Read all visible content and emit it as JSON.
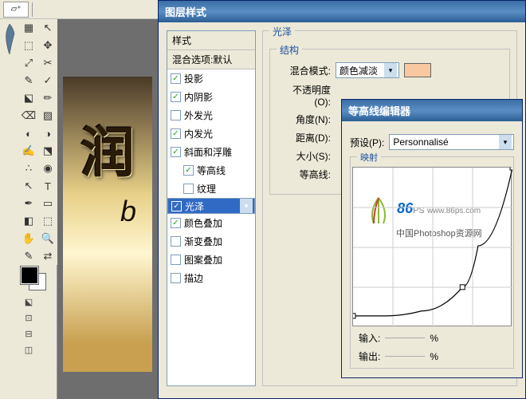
{
  "toolbar": {
    "selector": "▱⁺"
  },
  "toolbox": {
    "tools": [
      "▦",
      "↖",
      "⬚",
      "✥",
      "⤢",
      "✂",
      "✎",
      "✓",
      "⬕",
      "✏",
      "⌫",
      "▨",
      "◐",
      "◑",
      "✍",
      "⬔",
      "∴",
      "◉",
      "↖",
      "T",
      "✒",
      "▭",
      "◧",
      "⬚",
      "✋",
      "🔍",
      "✎",
      "⇄"
    ],
    "mini": [
      "⬕",
      "⊡",
      "⊟",
      "◫"
    ]
  },
  "canvas": {
    "text": "润",
    "sub": "b"
  },
  "layerStyle": {
    "title": "图层样式",
    "stylesHeader": "样式",
    "blendHeader": "混合选项:默认",
    "items": [
      {
        "label": "投影",
        "checked": true
      },
      {
        "label": "内阴影",
        "checked": true
      },
      {
        "label": "外发光",
        "checked": false
      },
      {
        "label": "内发光",
        "checked": true
      },
      {
        "label": "斜面和浮雕",
        "checked": true
      },
      {
        "label": "等高线",
        "checked": true,
        "indent": true
      },
      {
        "label": "纹理",
        "checked": false,
        "indent": true
      },
      {
        "label": "光泽",
        "checked": true,
        "selected": true
      },
      {
        "label": "颜色叠加",
        "checked": true
      },
      {
        "label": "渐变叠加",
        "checked": false
      },
      {
        "label": "图案叠加",
        "checked": false
      },
      {
        "label": "描边",
        "checked": false
      }
    ],
    "panelTitle": "光泽",
    "structTitle": "结构",
    "blendModeLabel": "混合模式:",
    "blendModeVal": "颜色减淡",
    "opacityLabel": "不透明度(O):",
    "angleLabel": "角度(N):",
    "distanceLabel": "距离(D):",
    "sizeLabel": "大小(S):",
    "contourLabel": "等高线:"
  },
  "contourEditor": {
    "title": "等高线编辑器",
    "presetLabel": "预设(P):",
    "presetVal": "Personnalisé",
    "mappingTitle": "映射",
    "inputLabel": "输入:",
    "outputLabel": "输出:",
    "pct": "%",
    "watermark": {
      "brand": "86",
      "suffix": "PS",
      "url": "www.86ps.com",
      "sub": "中国Photoshop资源网"
    }
  },
  "chart_data": {
    "type": "line",
    "title": "映射",
    "xlabel": "输入",
    "ylabel": "输出",
    "xlim": [
      0,
      255
    ],
    "ylim": [
      0,
      255
    ],
    "x": [
      0,
      50,
      110,
      175,
      200,
      255
    ],
    "values": [
      18,
      18,
      26,
      64,
      130,
      255
    ]
  }
}
